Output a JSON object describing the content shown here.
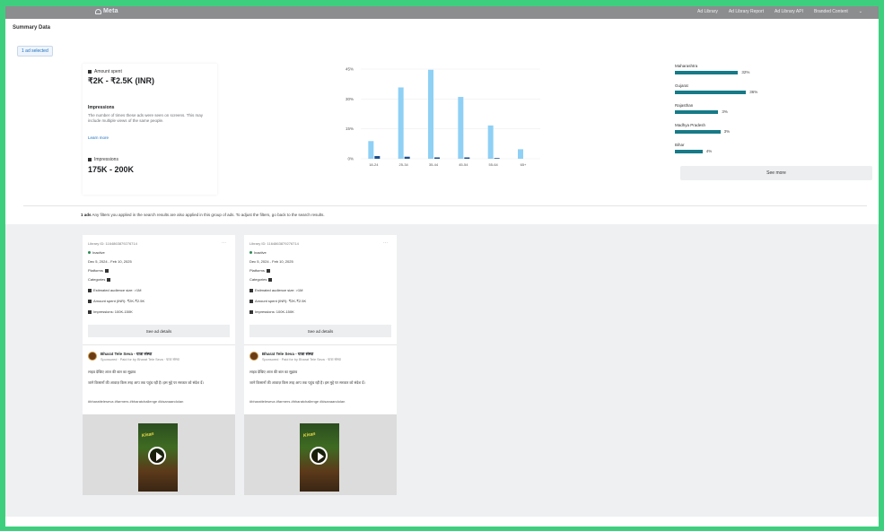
{
  "header": {
    "logo_text": "Meta",
    "nav": [
      "Ad Library",
      "Ad Library Report",
      "Ad Library API",
      "Branded Content"
    ]
  },
  "page": {
    "title": "Summary Data",
    "tab": "1 ad selected"
  },
  "spend": {
    "label": "Amount spent",
    "value": "₹2K - ₹2.5K (INR)",
    "impressions_heading": "Impressions",
    "impressions_desc": "The number of times these ads were seen on screens. This may include multiple views of the same people.",
    "learn_more": "Learn more",
    "impressions_label": "Impressions",
    "impressions_value": "175K - 200K"
  },
  "chart_data": {
    "type": "bar",
    "categories": [
      "18-24",
      "25-34",
      "35-44",
      "45-54",
      "55-64",
      "65+"
    ],
    "series": [
      {
        "values": [
          26,
          105,
          131,
          91,
          49,
          14
        ]
      },
      {
        "values": [
          4,
          3,
          2,
          2,
          1,
          0
        ]
      }
    ],
    "y_ticks": [
      "0%",
      "15%",
      "30%",
      "45%"
    ],
    "ylim": [
      0,
      132
    ],
    "colors": [
      "#8fd0f5",
      "#1a4e8c"
    ]
  },
  "demographics": {
    "rows": [
      {
        "label": "Maharashtra",
        "pct": "32%",
        "value": 32
      },
      {
        "label": "Gujarat",
        "pct": "36%",
        "value": 36
      },
      {
        "label": "Rajasthan",
        "pct": "3%",
        "value": 22
      },
      {
        "label": "Madhya Pradesh",
        "pct": "3%",
        "value": 23
      },
      {
        "label": "Bihar",
        "pct": "4%",
        "value": 14
      }
    ],
    "see_more": "See more",
    "bar_color": "#177a87"
  },
  "notice": {
    "bold": "1 ads",
    "text": "Any filters you applied in the search results are also applied in this group of ads. To adjust the filters, go back to the search results."
  },
  "ads": [
    {
      "library_id": "Library ID: 1164863879276714",
      "status": "Inactive",
      "dates": "Dec 5, 2024 - Feb 10, 2025",
      "platforms_label": "Platforms",
      "categories_label": "Categories",
      "estimated_audience": "Estimated audience size: >1M",
      "amount_spent": "Amount spent (INR): ₹2K-₹2.5K",
      "impressions": "Impressions: 100K-150K",
      "see_details": "See ad details",
      "advertiser": "Bharat Tele Seva - यात्रा संस्था",
      "sponsored": "Sponsored · Paid for by Bharat Tele Seva · यात्रा संस्था",
      "body_1": "लाइव देखिए आज की बात का सुझाव",
      "body_2": "जाने किसानों की आवाज़ किस तरह आप तक पहुंच रही है। इस मुद्दे पर सरकार को संदेश दें।",
      "body_3": "#bharatteleseva #farmers #bharatchallenge #kisanaandolan"
    },
    {
      "library_id": "Library ID: 1164863879276714",
      "status": "Inactive",
      "dates": "Dec 5, 2024 - Feb 10, 2025",
      "platforms_label": "Platforms",
      "categories_label": "Categories",
      "estimated_audience": "Estimated audience size: >1M",
      "amount_spent": "Amount spent (INR): ₹2K-₹2.5K",
      "impressions": "Impressions: 100K-150K",
      "see_details": "See ad details",
      "advertiser": "Bharat Tele Seva - यात्रा संस्था",
      "sponsored": "Sponsored · Paid for by Bharat Tele Seva · यात्रा संस्था",
      "body_1": "लाइव देखिए आज की बात का सुझाव",
      "body_2": "जाने किसानों की आवाज़ किस तरह आप तक पहुंच रही है। इस मुद्दे पर सरकार को संदेश दें।",
      "body_3": "#bharatteleseva #farmers #bharatchallenge #kisanaandolan"
    }
  ]
}
